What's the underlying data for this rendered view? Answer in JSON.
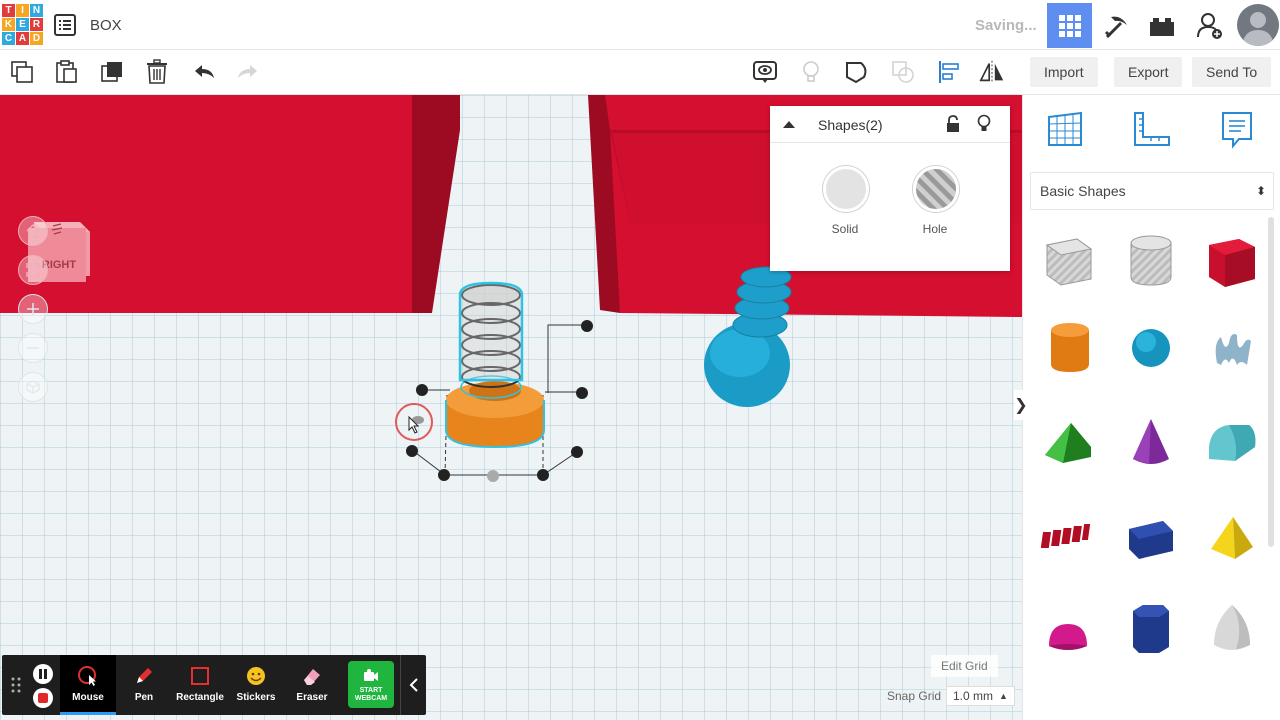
{
  "app": {
    "logo_letters": [
      "T",
      "I",
      "N",
      "K",
      "E",
      "R",
      "C",
      "A",
      "D"
    ],
    "logo_colors": [
      "#e23b3b",
      "#f5a623",
      "#2fa9df",
      "#f5a623",
      "#2fa9df",
      "#e23b3b",
      "#2fa9df",
      "#e23b3b",
      "#f5a623"
    ],
    "project_title": "BOX",
    "status": "Saving...",
    "accent_color": "#5e8ff0"
  },
  "topbar_icons": [
    {
      "name": "3d-view-icon",
      "active": true
    },
    {
      "name": "pickaxe-icon",
      "active": false
    },
    {
      "name": "bricks-icon",
      "active": false
    },
    {
      "name": "add-user-icon",
      "active": false
    }
  ],
  "toolbar": {
    "left_tools": [
      "copy-icon",
      "paste-icon",
      "duplicate-icon",
      "delete-icon",
      "undo-icon",
      "redo-icon"
    ],
    "right_tools": [
      "notes-icon",
      "light-bulb-icon",
      "group-icon",
      "ungroup-icon",
      "align-icon",
      "mirror-icon"
    ],
    "import_label": "Import",
    "export_label": "Export",
    "send_to_label": "Send To"
  },
  "viewcube": {
    "label": "RIGHT"
  },
  "shape_panel": {
    "title": "Shapes(2)",
    "solid_label": "Solid",
    "hole_label": "Hole"
  },
  "sidebar": {
    "top_icons": [
      "workplane-icon",
      "ruler-icon",
      "notes-panel-icon"
    ],
    "library_selected": "Basic Shapes",
    "shapes": [
      "box-hole-icon",
      "cylinder-hole-icon",
      "box-icon",
      "cylinder-icon",
      "sphere-icon",
      "scribble-icon",
      "roof-icon",
      "cone-icon",
      "round-roof-icon",
      "text-icon",
      "prism-icon",
      "pyramid-icon",
      "half-sphere-icon",
      "polygon-icon",
      "paraboloid-icon"
    ]
  },
  "grid": {
    "edit_grid_label": "Edit Grid",
    "snap_grid_label": "Snap Grid",
    "snap_value": "1.0 mm"
  },
  "recorder": {
    "tools": [
      {
        "label": "Mouse",
        "active": true
      },
      {
        "label": "Pen",
        "active": false
      },
      {
        "label": "Rectangle",
        "active": false
      },
      {
        "label": "Stickers",
        "active": false
      },
      {
        "label": "Eraser",
        "active": false
      }
    ],
    "webcam_line1": "START",
    "webcam_line2": "WEBCAM"
  }
}
